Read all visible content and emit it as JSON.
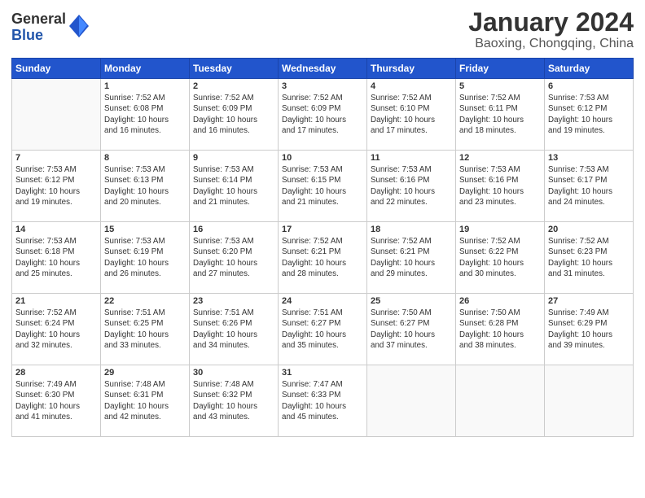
{
  "logo": {
    "line1": "General",
    "line2": "Blue"
  },
  "title": "January 2024",
  "location": "Baoxing, Chongqing, China",
  "days_of_week": [
    "Sunday",
    "Monday",
    "Tuesday",
    "Wednesday",
    "Thursday",
    "Friday",
    "Saturday"
  ],
  "weeks": [
    [
      {
        "day": "",
        "info": ""
      },
      {
        "day": "1",
        "info": "Sunrise: 7:52 AM\nSunset: 6:08 PM\nDaylight: 10 hours\nand 16 minutes."
      },
      {
        "day": "2",
        "info": "Sunrise: 7:52 AM\nSunset: 6:09 PM\nDaylight: 10 hours\nand 16 minutes."
      },
      {
        "day": "3",
        "info": "Sunrise: 7:52 AM\nSunset: 6:09 PM\nDaylight: 10 hours\nand 17 minutes."
      },
      {
        "day": "4",
        "info": "Sunrise: 7:52 AM\nSunset: 6:10 PM\nDaylight: 10 hours\nand 17 minutes."
      },
      {
        "day": "5",
        "info": "Sunrise: 7:52 AM\nSunset: 6:11 PM\nDaylight: 10 hours\nand 18 minutes."
      },
      {
        "day": "6",
        "info": "Sunrise: 7:53 AM\nSunset: 6:12 PM\nDaylight: 10 hours\nand 19 minutes."
      }
    ],
    [
      {
        "day": "7",
        "info": "Sunrise: 7:53 AM\nSunset: 6:12 PM\nDaylight: 10 hours\nand 19 minutes."
      },
      {
        "day": "8",
        "info": "Sunrise: 7:53 AM\nSunset: 6:13 PM\nDaylight: 10 hours\nand 20 minutes."
      },
      {
        "day": "9",
        "info": "Sunrise: 7:53 AM\nSunset: 6:14 PM\nDaylight: 10 hours\nand 21 minutes."
      },
      {
        "day": "10",
        "info": "Sunrise: 7:53 AM\nSunset: 6:15 PM\nDaylight: 10 hours\nand 21 minutes."
      },
      {
        "day": "11",
        "info": "Sunrise: 7:53 AM\nSunset: 6:16 PM\nDaylight: 10 hours\nand 22 minutes."
      },
      {
        "day": "12",
        "info": "Sunrise: 7:53 AM\nSunset: 6:16 PM\nDaylight: 10 hours\nand 23 minutes."
      },
      {
        "day": "13",
        "info": "Sunrise: 7:53 AM\nSunset: 6:17 PM\nDaylight: 10 hours\nand 24 minutes."
      }
    ],
    [
      {
        "day": "14",
        "info": "Sunrise: 7:53 AM\nSunset: 6:18 PM\nDaylight: 10 hours\nand 25 minutes."
      },
      {
        "day": "15",
        "info": "Sunrise: 7:53 AM\nSunset: 6:19 PM\nDaylight: 10 hours\nand 26 minutes."
      },
      {
        "day": "16",
        "info": "Sunrise: 7:53 AM\nSunset: 6:20 PM\nDaylight: 10 hours\nand 27 minutes."
      },
      {
        "day": "17",
        "info": "Sunrise: 7:52 AM\nSunset: 6:21 PM\nDaylight: 10 hours\nand 28 minutes."
      },
      {
        "day": "18",
        "info": "Sunrise: 7:52 AM\nSunset: 6:21 PM\nDaylight: 10 hours\nand 29 minutes."
      },
      {
        "day": "19",
        "info": "Sunrise: 7:52 AM\nSunset: 6:22 PM\nDaylight: 10 hours\nand 30 minutes."
      },
      {
        "day": "20",
        "info": "Sunrise: 7:52 AM\nSunset: 6:23 PM\nDaylight: 10 hours\nand 31 minutes."
      }
    ],
    [
      {
        "day": "21",
        "info": "Sunrise: 7:52 AM\nSunset: 6:24 PM\nDaylight: 10 hours\nand 32 minutes."
      },
      {
        "day": "22",
        "info": "Sunrise: 7:51 AM\nSunset: 6:25 PM\nDaylight: 10 hours\nand 33 minutes."
      },
      {
        "day": "23",
        "info": "Sunrise: 7:51 AM\nSunset: 6:26 PM\nDaylight: 10 hours\nand 34 minutes."
      },
      {
        "day": "24",
        "info": "Sunrise: 7:51 AM\nSunset: 6:27 PM\nDaylight: 10 hours\nand 35 minutes."
      },
      {
        "day": "25",
        "info": "Sunrise: 7:50 AM\nSunset: 6:27 PM\nDaylight: 10 hours\nand 37 minutes."
      },
      {
        "day": "26",
        "info": "Sunrise: 7:50 AM\nSunset: 6:28 PM\nDaylight: 10 hours\nand 38 minutes."
      },
      {
        "day": "27",
        "info": "Sunrise: 7:49 AM\nSunset: 6:29 PM\nDaylight: 10 hours\nand 39 minutes."
      }
    ],
    [
      {
        "day": "28",
        "info": "Sunrise: 7:49 AM\nSunset: 6:30 PM\nDaylight: 10 hours\nand 41 minutes."
      },
      {
        "day": "29",
        "info": "Sunrise: 7:48 AM\nSunset: 6:31 PM\nDaylight: 10 hours\nand 42 minutes."
      },
      {
        "day": "30",
        "info": "Sunrise: 7:48 AM\nSunset: 6:32 PM\nDaylight: 10 hours\nand 43 minutes."
      },
      {
        "day": "31",
        "info": "Sunrise: 7:47 AM\nSunset: 6:33 PM\nDaylight: 10 hours\nand 45 minutes."
      },
      {
        "day": "",
        "info": ""
      },
      {
        "day": "",
        "info": ""
      },
      {
        "day": "",
        "info": ""
      }
    ]
  ]
}
